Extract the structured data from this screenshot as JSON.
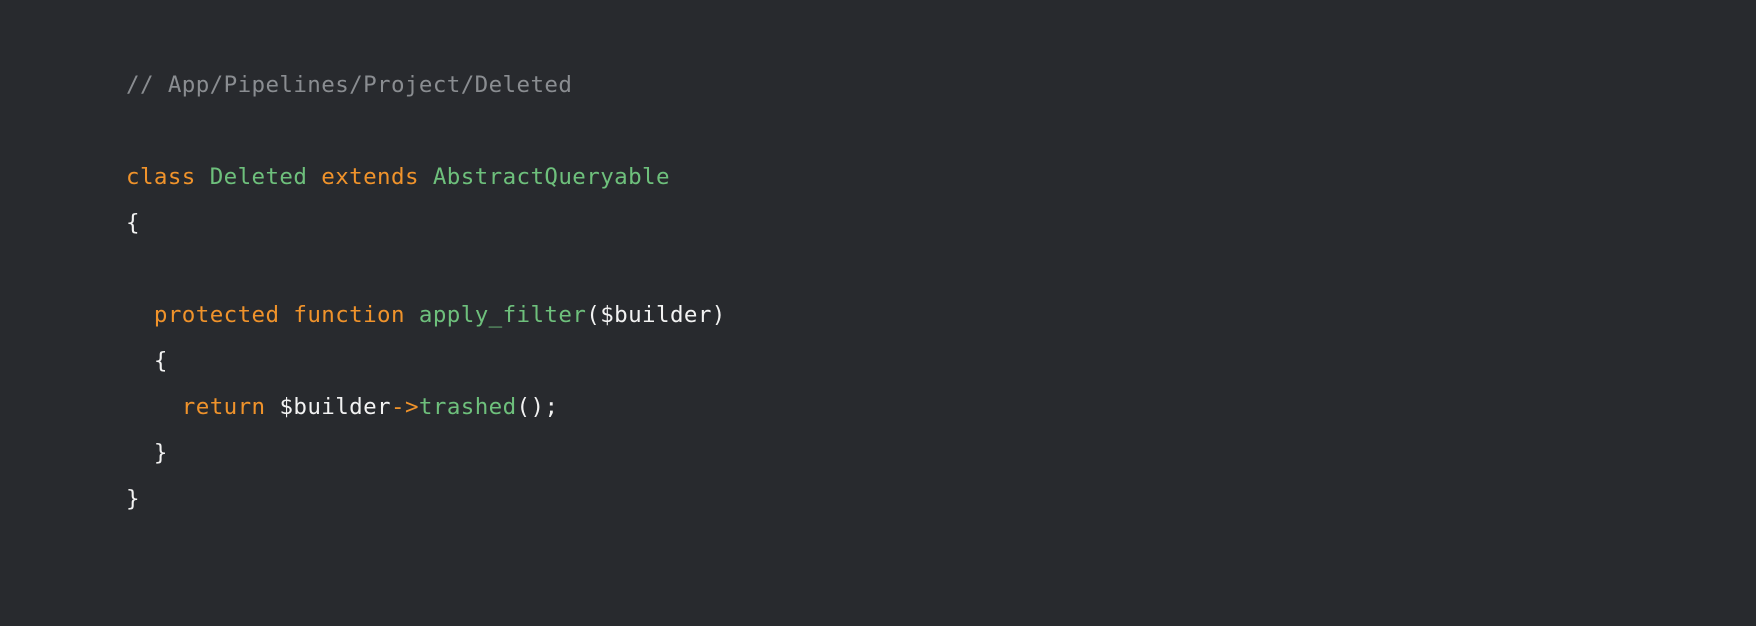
{
  "editor": {
    "background_color": "#282a2e",
    "language": "php",
    "colors": {
      "comment": "#8a8d91",
      "keyword": "#f0932b",
      "class_name": "#6ec07c",
      "function_name": "#6ec07c",
      "operator": "#f0932b",
      "variable": "#f2f2f2",
      "punctuation": "#f2f2f2"
    }
  },
  "code": {
    "lines": [
      {
        "indent": "",
        "tokens": [
          {
            "text": "// App/Pipelines/Project/Deleted",
            "type": "comment"
          }
        ]
      },
      {
        "indent": "",
        "tokens": []
      },
      {
        "indent": "",
        "tokens": [
          {
            "text": "class",
            "type": "keyword"
          },
          {
            "text": " ",
            "type": "plain"
          },
          {
            "text": "Deleted",
            "type": "class"
          },
          {
            "text": " ",
            "type": "plain"
          },
          {
            "text": "extends",
            "type": "keyword"
          },
          {
            "text": " ",
            "type": "plain"
          },
          {
            "text": "AbstractQueryable",
            "type": "class"
          }
        ]
      },
      {
        "indent": "",
        "tokens": [
          {
            "text": "{",
            "type": "punct"
          }
        ]
      },
      {
        "indent": "",
        "tokens": []
      },
      {
        "indent": "  ",
        "tokens": [
          {
            "text": "protected",
            "type": "keyword"
          },
          {
            "text": " ",
            "type": "plain"
          },
          {
            "text": "function",
            "type": "keyword"
          },
          {
            "text": " ",
            "type": "plain"
          },
          {
            "text": "apply_filter",
            "type": "func"
          },
          {
            "text": "(",
            "type": "punct"
          },
          {
            "text": "$builder",
            "type": "var"
          },
          {
            "text": ")",
            "type": "punct"
          }
        ]
      },
      {
        "indent": "  ",
        "tokens": [
          {
            "text": "{",
            "type": "punct"
          }
        ]
      },
      {
        "indent": "    ",
        "tokens": [
          {
            "text": "return",
            "type": "keyword"
          },
          {
            "text": " ",
            "type": "plain"
          },
          {
            "text": "$builder",
            "type": "var"
          },
          {
            "text": "->",
            "type": "operator"
          },
          {
            "text": "trashed",
            "type": "method"
          },
          {
            "text": "();",
            "type": "punct"
          }
        ]
      },
      {
        "indent": "  ",
        "tokens": [
          {
            "text": "}",
            "type": "punct"
          }
        ]
      },
      {
        "indent": "",
        "tokens": [
          {
            "text": "}",
            "type": "punct"
          }
        ]
      }
    ]
  }
}
